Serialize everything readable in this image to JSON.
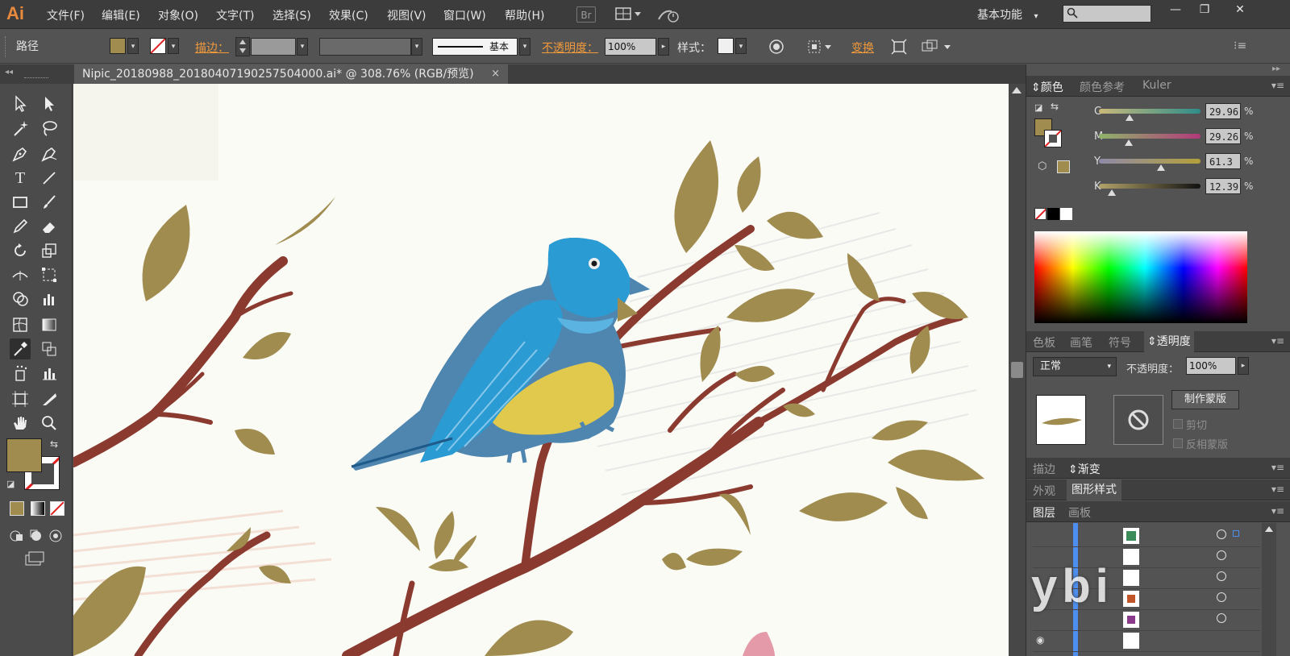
{
  "app": {
    "logo": "Ai"
  },
  "menu": [
    "文件(F)",
    "编辑(E)",
    "对象(O)",
    "文字(T)",
    "选择(S)",
    "效果(C)",
    "视图(V)",
    "窗口(W)",
    "帮助(H)"
  ],
  "menubar_icons": {
    "bridge": "Br",
    "arrange": "arrange-documents-icon",
    "gpu": "gpu-performance-icon"
  },
  "workspace": {
    "label": "基本功能",
    "arrow": "▾"
  },
  "search": {
    "placeholder": ""
  },
  "window_buttons": {
    "minimize": "—",
    "restore": "❐",
    "close": "✕"
  },
  "control": {
    "selection_type": "路径",
    "stroke_label": "描边：",
    "stroke_style": "基本",
    "opacity_label": "不透明度：",
    "opacity_value": "100%",
    "style_label": "样式：",
    "transform_label": "变换",
    "fill_color": "#a08c4f"
  },
  "document": {
    "tab_title": "Nipic_20180988_20180407190257504000.ai* @ 308.76% (RGB/预览)",
    "close": "×"
  },
  "colors": {
    "fill": "#a08c4f",
    "branch": "#8b3a2f",
    "leaf": "#a08c4f",
    "bird_blue": "#2b9bd4",
    "bird_body": "#4f86b0",
    "bird_belly": "#e1c94e",
    "paper": "#fbfbf6",
    "accent": "#f09a3c"
  },
  "color_panel": {
    "tabs": [
      "颜色",
      "颜色参考",
      "Kuler"
    ],
    "sliders": [
      {
        "label": "C",
        "value": "29.96",
        "level": 0.2996
      },
      {
        "label": "M",
        "value": "29.26",
        "level": 0.2926
      },
      {
        "label": "Y",
        "value": "61.3",
        "level": 0.613
      },
      {
        "label": "K",
        "value": "12.39",
        "level": 0.1239
      }
    ],
    "percent": "%"
  },
  "transparency_panel": {
    "tabs": [
      "色板",
      "画笔",
      "符号",
      "透明度"
    ],
    "blend_mode": "正常",
    "opacity_label": "不透明度：",
    "opacity_value": "100%",
    "make_mask": "制作蒙版",
    "clip": "剪切",
    "invert_mask": "反相蒙版"
  },
  "stroke_panel": {
    "tabs": [
      "描边",
      "渐变"
    ]
  },
  "appearance_panel": {
    "tabs": [
      "外观",
      "图形样式"
    ]
  },
  "layers_panel": {
    "tabs": [
      "图层",
      "画板"
    ],
    "row_count": 6
  },
  "watermark": {
    "text": "ybi"
  }
}
